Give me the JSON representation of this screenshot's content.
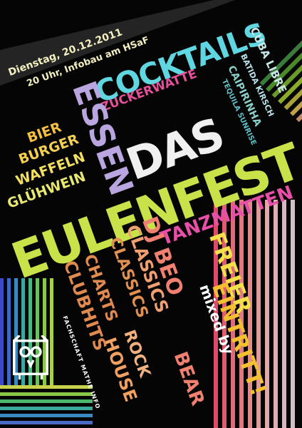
{
  "header": {
    "date_line": "Dienstag, 20.12.2011",
    "time_line": "20 Uhr, Infobau am HSaF"
  },
  "drinks": {
    "cocktails": "COCKTAILS",
    "cuba_libre": "CUBA LIBRE",
    "batida_kirsch": "BATIDA KIRSCH",
    "caipirinha": "CAIPIRINHA",
    "tequila_sunrise": "TEQUILA SUNRISE",
    "zuckerwatte": "ZUCKERWATTE"
  },
  "food": {
    "essen": "ESSEN",
    "bier": "BIER",
    "burger": "BURGER",
    "waffeln": "WAFFELN",
    "gluehwein": "GLÜHWEIN"
  },
  "title": {
    "das": "DAS",
    "eulenfest": "EULENFEST"
  },
  "tanzmatten": "TANZMATTEN",
  "music": {
    "dj_beo": "DJ BEO",
    "classics": "CLASSICS",
    "rock": "ROCK",
    "house": "HOUSE",
    "classics2": "CLASSICS",
    "charts": "CHARTS",
    "clubhits": "CLUBHITS"
  },
  "mixed_by": "mixed by",
  "bear": "BEAR",
  "freier": "FREIER",
  "eintritt": "EINTRITT!",
  "organizer": "FACHSCHAFT MATHE INFO",
  "colors": {
    "yellow": "#f4e04a",
    "cyan": "#5fd6e0",
    "pink": "#e84fa8",
    "lavender": "#b9a6e0",
    "olive": "#c9e24a",
    "orange": "#f29a3a",
    "salmon": "#f08070",
    "peach": "#e8a060"
  }
}
